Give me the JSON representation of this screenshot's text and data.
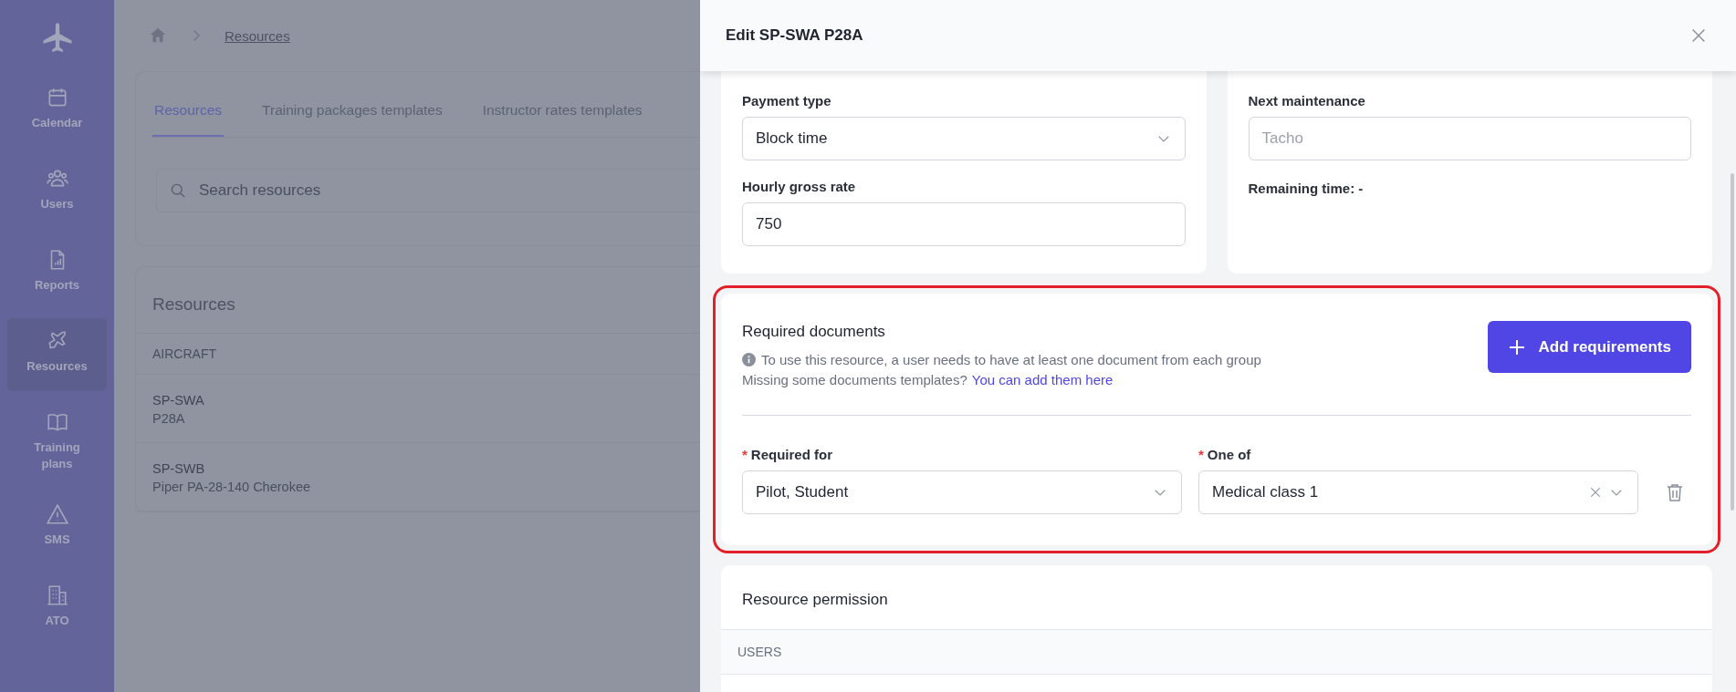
{
  "sidebar": {
    "items": [
      {
        "label": "Calendar",
        "selected": false
      },
      {
        "label": "Users",
        "selected": false
      },
      {
        "label": "Reports",
        "selected": false
      },
      {
        "label": "Resources",
        "selected": true
      },
      {
        "label": "Training plans",
        "selected": false
      },
      {
        "label": "SMS",
        "selected": false
      },
      {
        "label": "ATO",
        "selected": false
      }
    ]
  },
  "breadcrumb": {
    "link": "Resources"
  },
  "tabs": [
    {
      "label": "Resources",
      "selected": true
    },
    {
      "label": "Training packages templates",
      "selected": false
    },
    {
      "label": "Instructor rates templates",
      "selected": false
    }
  ],
  "search": {
    "placeholder": "Search resources"
  },
  "resources": {
    "title": "Resources",
    "column": "AIRCRAFT",
    "rows": [
      {
        "code": "SP-SWA",
        "model": "P28A"
      },
      {
        "code": "SP-SWB",
        "model": "Piper PA-28-140 Cherokee"
      }
    ]
  },
  "drawer": {
    "title": "Edit SP-SWA P28A",
    "payment_type": {
      "label": "Payment type",
      "value": "Block time"
    },
    "hourly_rate": {
      "label": "Hourly gross rate",
      "value": "750"
    },
    "next_maintenance": {
      "label": "Next maintenance",
      "placeholder": "Tacho"
    },
    "remaining_time": "Remaining time: -",
    "required_documents": {
      "title": "Required documents",
      "highlighted": true,
      "info": "To use this resource, a user needs to have at least one document from each group",
      "missing_text": "Missing some documents templates?",
      "link": "You can add them here",
      "button": "Add requirements",
      "rows": [
        {
          "required_for": {
            "marker": "*",
            "label": "Required for",
            "value": "Pilot, Student"
          },
          "one_of": {
            "marker": "*",
            "label": "One of",
            "value": "Medical class 1"
          }
        }
      ]
    },
    "permission": {
      "title": "Resource permission",
      "column": "USERS"
    }
  }
}
